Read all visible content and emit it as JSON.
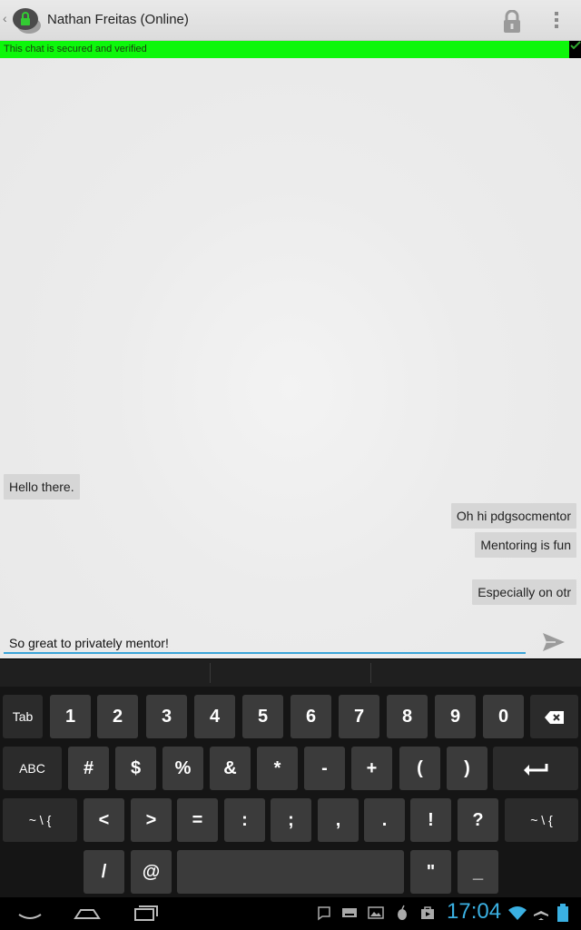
{
  "header": {
    "back_caret": "‹",
    "app_icon": "gibberbot-lock-chat-icon",
    "title": "Nathan Freitas (Online)",
    "lock_icon": "padlock-icon",
    "overflow_icon": "overflow-menu-icon"
  },
  "security": {
    "status_text": "This chat is secured and verified",
    "status_color": "#0df70b",
    "verified_icon": "check-icon"
  },
  "messages": [
    {
      "text": "Hello there.",
      "direction": "incoming"
    },
    {
      "text": "Oh hi pdgsocmentor",
      "direction": "outgoing"
    },
    {
      "text": "Mentoring is fun",
      "direction": "outgoing"
    },
    {
      "text": "Especially on otr",
      "direction": "outgoing"
    }
  ],
  "composer": {
    "value": "So great to privately mentor!",
    "send_icon": "send-icon",
    "accent_color": "#3aa4d8"
  },
  "keyboard": {
    "row1": [
      "Tab",
      "1",
      "2",
      "3",
      "4",
      "5",
      "6",
      "7",
      "8",
      "9",
      "0"
    ],
    "row2": [
      "ABC",
      "#",
      "$",
      "%",
      "&",
      "*",
      "-",
      "+",
      "(",
      ")"
    ],
    "row3": [
      "~ \\ {",
      "<",
      ">",
      "=",
      ":",
      ";",
      ",",
      ".",
      "!",
      "?",
      "~ \\ {"
    ],
    "row4": [
      "/",
      "@",
      "",
      "\"",
      "_"
    ],
    "backspace_icon": "backspace-icon",
    "enter_icon": "enter-icon"
  },
  "statusbar": {
    "time": "17:04",
    "clock_color": "#3ab0e2",
    "nav_icons": [
      "back-icon",
      "home-icon",
      "recent-apps-icon"
    ],
    "notification_icons": [
      "chat-notification-icon",
      "keyboard-notification-icon",
      "gallery-notification-icon",
      "orbot-notification-icon",
      "app-store-notification-icon"
    ],
    "system_icons": [
      "wifi-icon",
      "airplane-icon",
      "battery-icon"
    ]
  }
}
